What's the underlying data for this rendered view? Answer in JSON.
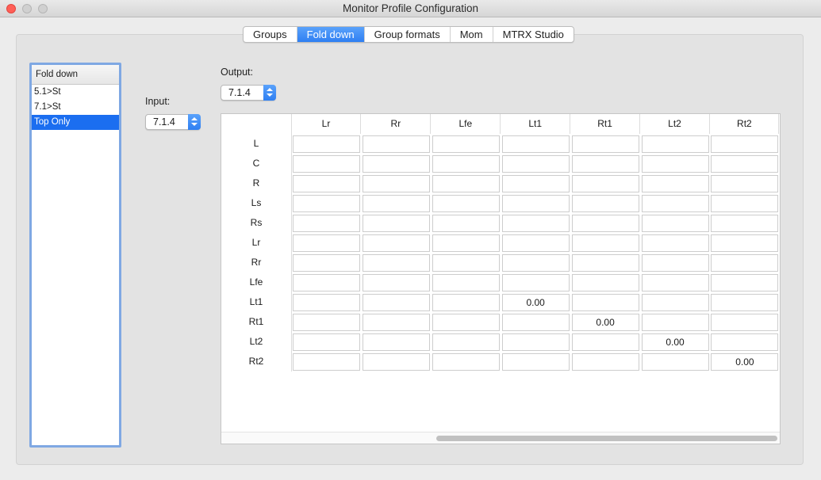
{
  "window": {
    "title": "Monitor Profile Configuration"
  },
  "tabs": [
    {
      "label": "Groups",
      "active": false
    },
    {
      "label": "Fold down",
      "active": true
    },
    {
      "label": "Group formats",
      "active": false
    },
    {
      "label": "Mom",
      "active": false
    },
    {
      "label": "MTRX Studio",
      "active": false
    }
  ],
  "list": {
    "header": "Fold down",
    "items": [
      "5.1>St",
      "7.1>St",
      "Top Only"
    ],
    "selected_index": 2
  },
  "input": {
    "label": "Input:",
    "value": "7.1.4"
  },
  "output": {
    "label": "Output:",
    "value": "7.1.4"
  },
  "matrix": {
    "columns": [
      "Lr",
      "Rr",
      "Lfe",
      "Lt1",
      "Rt1",
      "Lt2",
      "Rt2"
    ],
    "rows": [
      {
        "label": "L",
        "cells": [
          "",
          "",
          "",
          "",
          "",
          "",
          ""
        ]
      },
      {
        "label": "C",
        "cells": [
          "",
          "",
          "",
          "",
          "",
          "",
          ""
        ]
      },
      {
        "label": "R",
        "cells": [
          "",
          "",
          "",
          "",
          "",
          "",
          ""
        ]
      },
      {
        "label": "Ls",
        "cells": [
          "",
          "",
          "",
          "",
          "",
          "",
          ""
        ]
      },
      {
        "label": "Rs",
        "cells": [
          "",
          "",
          "",
          "",
          "",
          "",
          ""
        ]
      },
      {
        "label": "Lr",
        "cells": [
          "",
          "",
          "",
          "",
          "",
          "",
          ""
        ]
      },
      {
        "label": "Rr",
        "cells": [
          "",
          "",
          "",
          "",
          "",
          "",
          ""
        ]
      },
      {
        "label": "Lfe",
        "cells": [
          "",
          "",
          "",
          "",
          "",
          "",
          ""
        ]
      },
      {
        "label": "Lt1",
        "cells": [
          "",
          "",
          "",
          "0.00",
          "",
          "",
          ""
        ]
      },
      {
        "label": "Rt1",
        "cells": [
          "",
          "",
          "",
          "",
          "0.00",
          "",
          ""
        ]
      },
      {
        "label": "Lt2",
        "cells": [
          "",
          "",
          "",
          "",
          "",
          "0.00",
          ""
        ]
      },
      {
        "label": "Rt2",
        "cells": [
          "",
          "",
          "",
          "",
          "",
          "",
          "0.00"
        ]
      }
    ]
  },
  "colors": {
    "accent": "#2f7ff2",
    "list_selection": "#1b6ef0",
    "list_focus_ring": "#7fa8e3",
    "close_button": "#ff5f57"
  }
}
